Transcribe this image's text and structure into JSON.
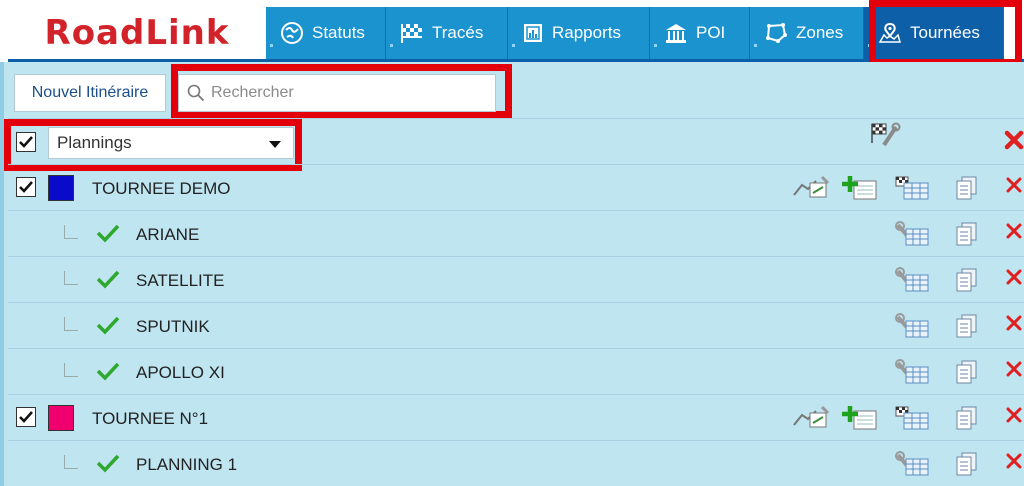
{
  "brand": {
    "logo_text": "RoadLink",
    "color": "#d3232a"
  },
  "nav": {
    "items": [
      {
        "label": "Statuts",
        "icon": "globe-icon"
      },
      {
        "label": "Tracés",
        "icon": "checkered-flag-icon"
      },
      {
        "label": "Rapports",
        "icon": "report-icon"
      },
      {
        "label": "POI",
        "icon": "bank-icon"
      },
      {
        "label": "Zones",
        "icon": "zone-icon"
      },
      {
        "label": "Tournées",
        "icon": "route-icon",
        "active": true
      }
    ]
  },
  "toolbar": {
    "new_itinerary_label": "Nouvel Itinéraire",
    "search_placeholder": "Rechercher"
  },
  "filter": {
    "selected": "Plannings",
    "checked": true
  },
  "tours": [
    {
      "name": "TOURNEE DEMO",
      "color": "#0a0acb",
      "checked": true,
      "plannings": [
        "ARIANE",
        "SATELLITE",
        "SPUTNIK",
        "APOLLO XI"
      ]
    },
    {
      "name": "TOURNEE N°1",
      "color": "#f0006e",
      "checked": true,
      "plannings": [
        "PLANNING 1"
      ]
    }
  ],
  "colors": {
    "panel": "#bfe5f1",
    "nav": "#1a93cf",
    "nav_active": "#0d5fa8",
    "highlight": "#e4000b",
    "delete": "#e02020",
    "tick": "#2ea82e"
  }
}
